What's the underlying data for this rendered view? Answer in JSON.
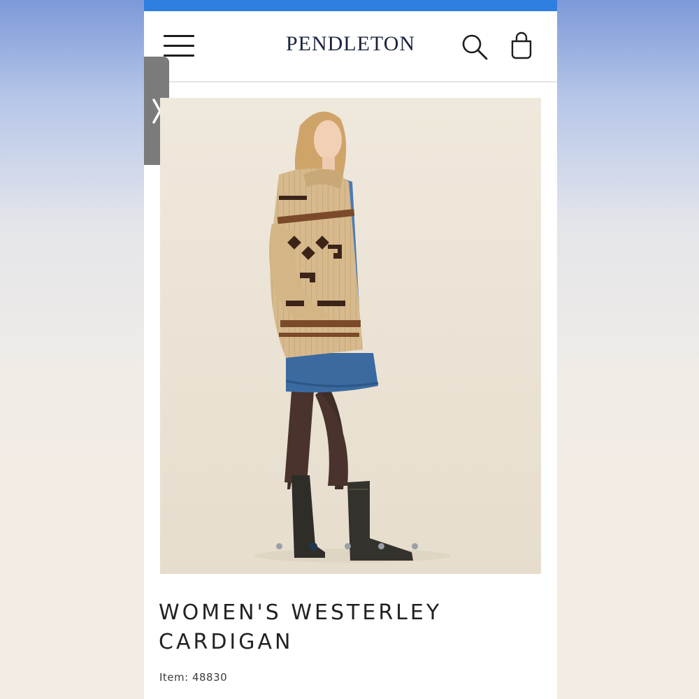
{
  "header": {
    "brand": "PENDLETON",
    "menu_icon": "hamburger-menu-icon",
    "search_icon": "search-icon",
    "bag_icon": "shopping-bag-icon"
  },
  "side_tab": {
    "icon": "chevron-right-icon"
  },
  "gallery": {
    "image_alt": "Model wearing tan and brown patterned cardigan with denim dress and black cowboy boots",
    "dot_count": 5,
    "active_index": 1
  },
  "product": {
    "title_line1": "WOMEN'S WESTERLEY",
    "title_line2": "CARDIGAN",
    "item_label": "Item: 48830"
  },
  "colors": {
    "top_bar": "#2f7fe0",
    "brand_text": "#1b2340",
    "active_dot": "#1f3552",
    "inactive_dot": "#9aa0a6"
  }
}
